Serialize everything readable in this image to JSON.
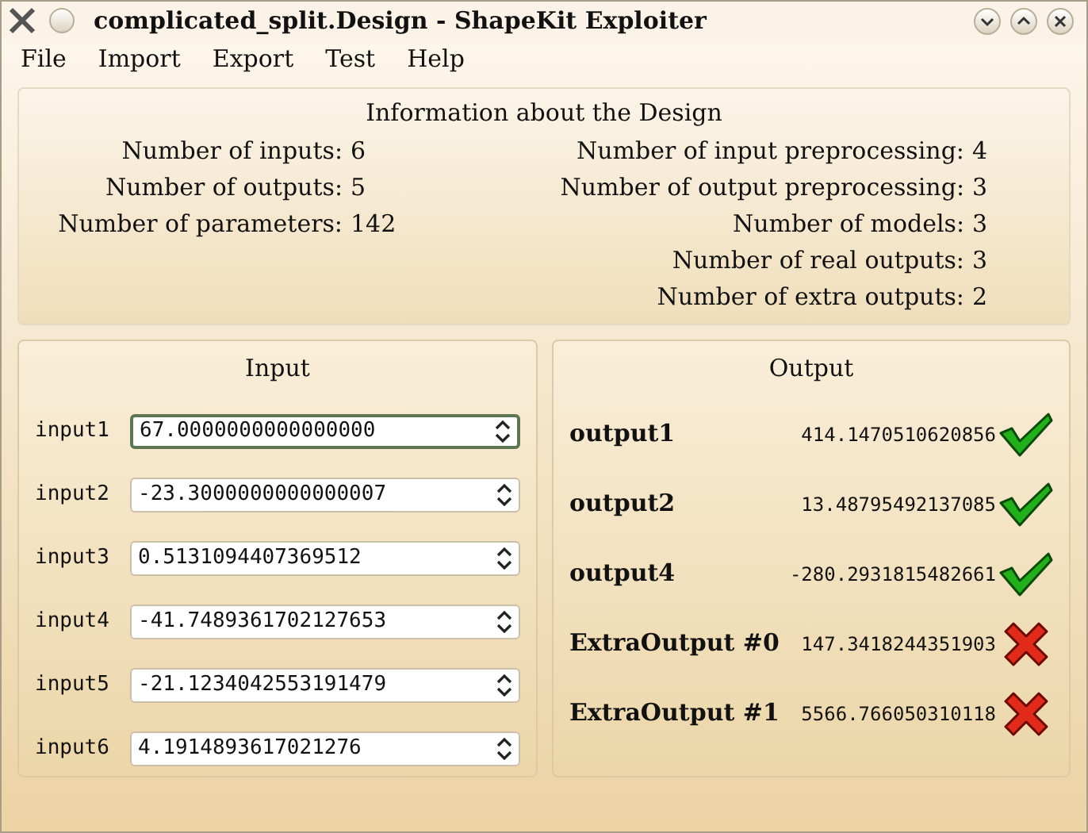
{
  "window": {
    "title": "complicated_split.Design - ShapeKit Exploiter"
  },
  "menu": [
    "File",
    "Import",
    "Export",
    "Test",
    "Help"
  ],
  "info": {
    "title": "Information about the Design",
    "left": [
      {
        "label": "Number of inputs:",
        "value": "6"
      },
      {
        "label": "Number of outputs:",
        "value": "5"
      },
      {
        "label": "Number of parameters:",
        "value": "142"
      }
    ],
    "right": [
      {
        "label": "Number of input preprocessing:",
        "value": "4"
      },
      {
        "label": "Number of output preprocessing:",
        "value": "3"
      },
      {
        "label": "Number of models:",
        "value": "3"
      },
      {
        "label": "Number of real outputs:",
        "value": "3"
      },
      {
        "label": "Number of extra outputs:",
        "value": "2"
      }
    ]
  },
  "input_panel": {
    "title": "Input",
    "inputs": [
      {
        "label": "input1",
        "value": "67.0000000000000000",
        "focused": true
      },
      {
        "label": "input2",
        "value": "-23.3000000000000007",
        "focused": false
      },
      {
        "label": "input3",
        "value": "0.5131094407369512",
        "focused": false
      },
      {
        "label": "input4",
        "value": "-41.7489361702127653",
        "focused": false
      },
      {
        "label": "input5",
        "value": "-21.1234042553191479",
        "focused": false
      },
      {
        "label": "input6",
        "value": "4.1914893617021276",
        "focused": false
      }
    ]
  },
  "output_panel": {
    "title": "Output",
    "outputs": [
      {
        "label": "output1",
        "value": "414.1470510620856",
        "ok": true
      },
      {
        "label": "output2",
        "value": "13.48795492137085",
        "ok": true
      },
      {
        "label": "output4",
        "value": "-280.2931815482661",
        "ok": true
      },
      {
        "label": "ExtraOutput #0",
        "value": "147.3418244351903",
        "ok": false
      },
      {
        "label": "ExtraOutput #1",
        "value": "5566.766050310118",
        "ok": false
      }
    ]
  }
}
